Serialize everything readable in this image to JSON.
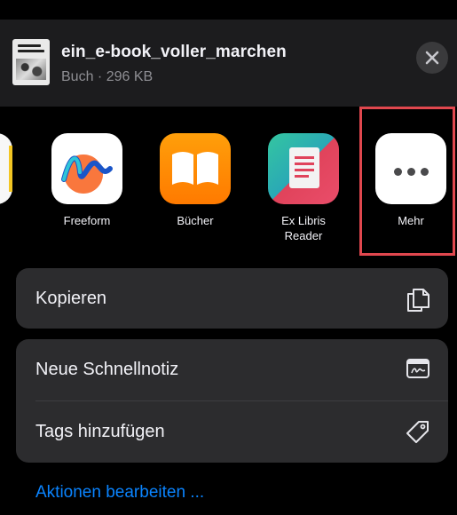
{
  "header": {
    "file_name": "ein_e-book_voller_marchen",
    "file_meta": "Buch · 296 KB"
  },
  "apps": [
    {
      "label": "Freeform",
      "icon": "freeform-icon"
    },
    {
      "label": "Bücher",
      "icon": "books-icon"
    },
    {
      "label": "Ex Libris Reader",
      "icon": "exlibris-icon"
    },
    {
      "label": "Mehr",
      "icon": "more-icon",
      "highlighted": true
    }
  ],
  "actions": {
    "copy_label": "Kopieren",
    "quick_note_label": "Neue Schnellnotiz",
    "tags_label": "Tags hinzufügen"
  },
  "edit_actions_label": "Aktionen bearbeiten ...",
  "colors": {
    "background": "#000000",
    "sheet": "#1c1c1e",
    "row": "#2c2c2e",
    "link": "#0a84ff",
    "highlight": "#e0474e"
  }
}
